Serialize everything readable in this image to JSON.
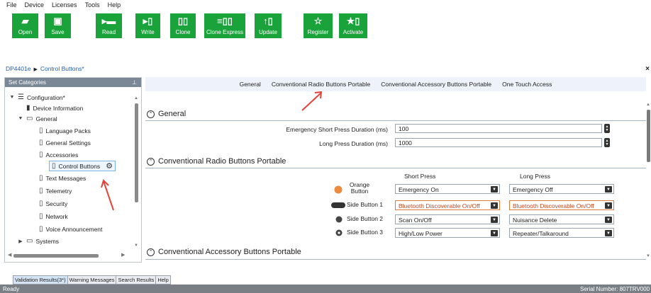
{
  "menu": [
    "File",
    "Device",
    "Licenses",
    "Tools",
    "Help"
  ],
  "toolbar": {
    "open": "Open",
    "save": "Save",
    "read": "Read",
    "write": "Write",
    "clone": "Clone",
    "clone_express": "Clone Express",
    "update": "Update",
    "register": "Register",
    "activate": "Activate"
  },
  "breadcrumb": {
    "root": "DP4401e",
    "current": "Control Buttons*"
  },
  "sidebar": {
    "title": "Set Categories",
    "configuration": "Configuration*",
    "device_information": "Device Information",
    "general": "General",
    "language_packs": "Language Packs",
    "general_settings": "General Settings",
    "accessories": "Accessories",
    "control_buttons": "Control Buttons",
    "text_messages": "Text Messages",
    "telemetry": "Telemetry",
    "security": "Security",
    "network": "Network",
    "voice_announcement": "Voice Announcement",
    "systems": "Systems"
  },
  "tabs": [
    "General",
    "Conventional Radio Buttons Portable",
    "Conventional Accessory Buttons Portable",
    "One Touch Access"
  ],
  "general": {
    "title": "General",
    "short_press_label": "Emergency Short Press Duration (ms)",
    "short_press_value": "100",
    "long_press_label": "Long Press Duration (ms)",
    "long_press_value": "1000"
  },
  "radio_buttons": {
    "title": "Conventional Radio Buttons Portable",
    "col_short": "Short Press",
    "col_long": "Long Press",
    "rows": [
      {
        "name": "Orange Button",
        "short": "Emergency On",
        "long": "Emergency Off",
        "color": "#f08a3c"
      },
      {
        "name": "Side Button 1",
        "short": "Bluetooth Discoverable On/Off",
        "long": "Bluetooth Discoverable On/Off",
        "color": "#333333"
      },
      {
        "name": "Side Button 2",
        "short": "Scan On/Off",
        "long": "Nuisance Delete",
        "color": "#444444"
      },
      {
        "name": "Side Button 3",
        "short": "High/Low Power",
        "long": "Repeater/Talkaround",
        "color": "#444444"
      }
    ]
  },
  "accessory": {
    "title": "Conventional Accessory Buttons Portable"
  },
  "bottom_tabs": [
    "Validation Results(3*)",
    "Warning Messages",
    "Search Results",
    "Help"
  ],
  "status": {
    "left": "Ready",
    "right": "Serial Number: 807TRV000"
  },
  "colors": {
    "toolbar_green": "#1aa33b",
    "annotation_red": "#e0443a",
    "alert_orange": "#e07b39"
  }
}
